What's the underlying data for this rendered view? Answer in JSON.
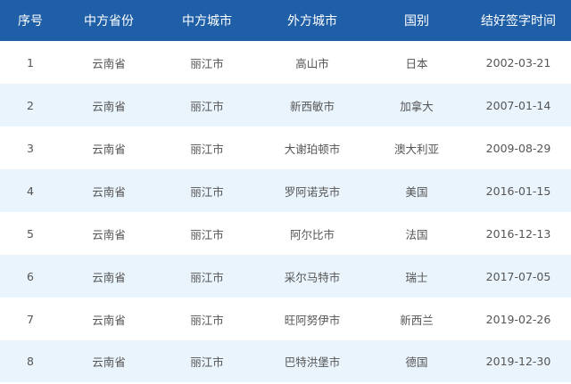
{
  "table": {
    "headers": [
      "序号",
      "中方省份",
      "中方城市",
      "外方城市",
      "国别",
      "结好签字时间"
    ],
    "rows": [
      [
        "1",
        "云南省",
        "丽江市",
        "高山市",
        "日本",
        "2002-03-21"
      ],
      [
        "2",
        "云南省",
        "丽江市",
        "新西敏市",
        "加拿大",
        "2007-01-14"
      ],
      [
        "3",
        "云南省",
        "丽江市",
        "大谢珀顿市",
        "澳大利亚",
        "2009-08-29"
      ],
      [
        "4",
        "云南省",
        "丽江市",
        "罗阿诺克市",
        "美国",
        "2016-01-15"
      ],
      [
        "5",
        "云南省",
        "丽江市",
        "阿尔比市",
        "法国",
        "2016-12-13"
      ],
      [
        "6",
        "云南省",
        "丽江市",
        "采尔马特市",
        "瑞士",
        "2017-07-05"
      ],
      [
        "7",
        "云南省",
        "丽江市",
        "旺阿努伊市",
        "新西兰",
        "2019-02-26"
      ],
      [
        "8",
        "云南省",
        "丽江市",
        "巴特洪堡市",
        "德国",
        "2019-12-30"
      ]
    ]
  },
  "colors": {
    "header_bg": "#1f5fa8",
    "header_text": "#ffffff",
    "stripe_bg": "#eaf4fc",
    "cell_text": "#555555"
  }
}
